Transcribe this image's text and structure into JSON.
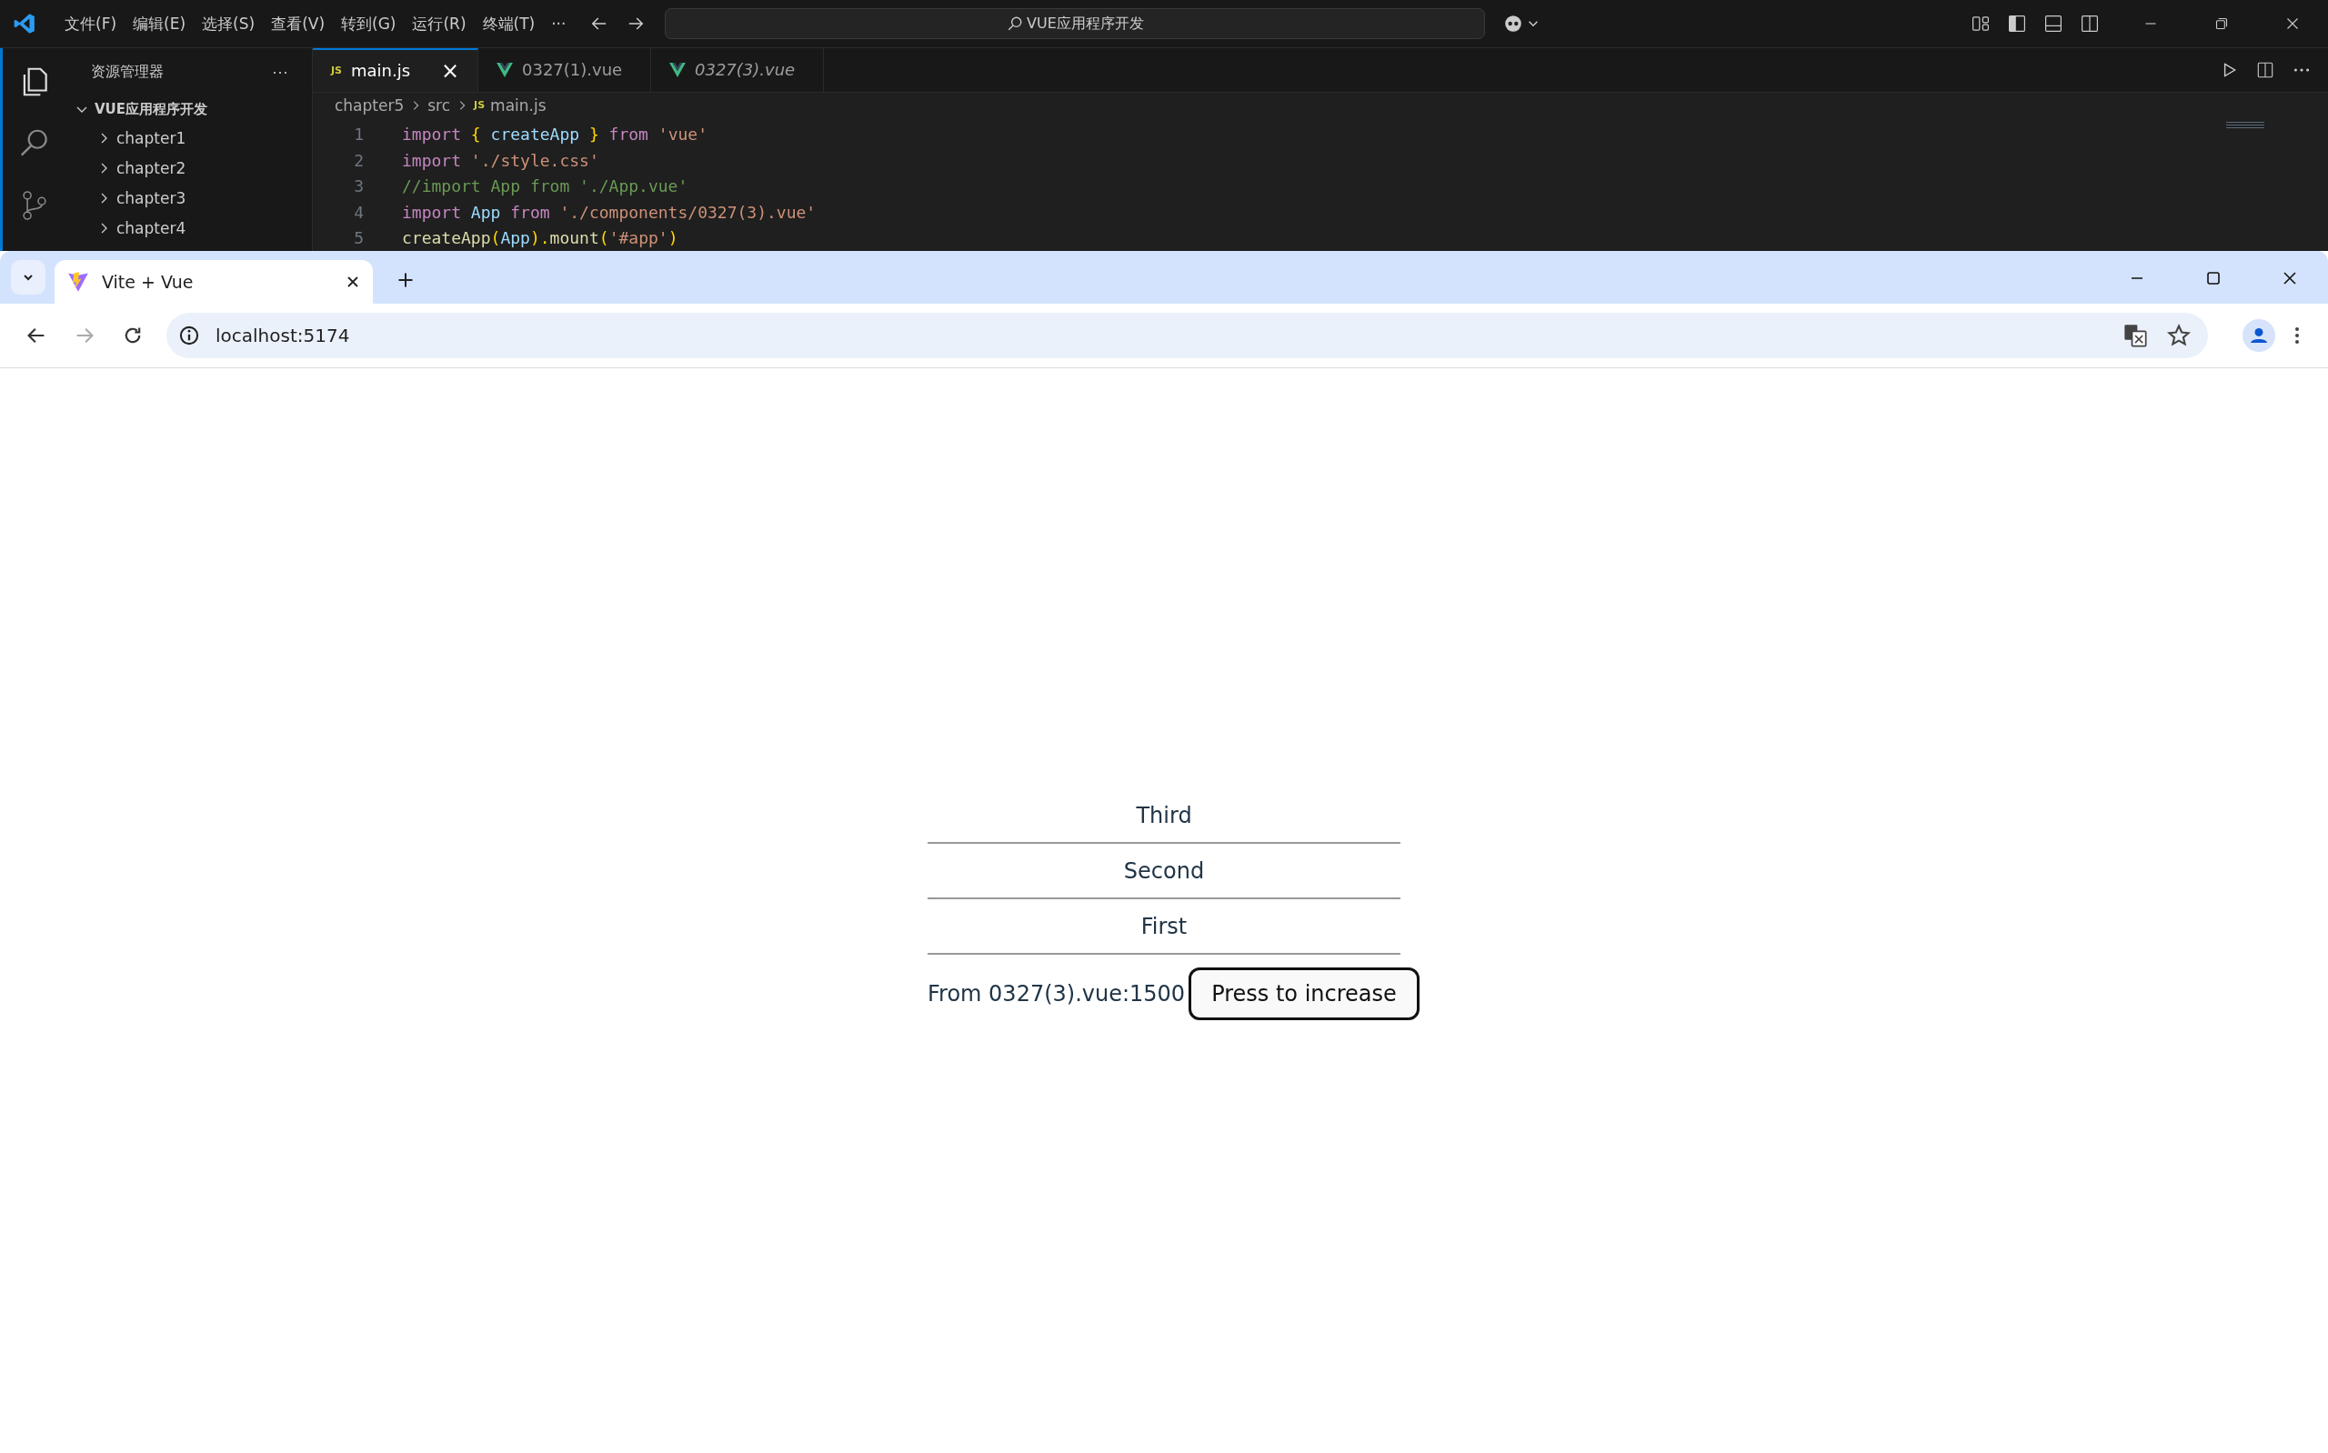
{
  "editor": {
    "menu": [
      "文件(F)",
      "编辑(E)",
      "选择(S)",
      "查看(V)",
      "转到(G)",
      "运行(R)",
      "终端(T)"
    ],
    "menu_more": "···",
    "command_center": "VUE应用程序开发",
    "explorer": {
      "title": "资源管理器",
      "more": "···",
      "root": {
        "label": "VUE应用程序开发",
        "expanded": true,
        "children": [
          {
            "label": "chapter1",
            "expanded": false
          },
          {
            "label": "chapter2",
            "expanded": false
          },
          {
            "label": "chapter3",
            "expanded": false
          },
          {
            "label": "chapter4",
            "expanded": false
          }
        ]
      }
    },
    "tabs": [
      {
        "label": "main.js",
        "kind": "js",
        "badge": "JS",
        "selected": true,
        "italic": false,
        "close": "×"
      },
      {
        "label": "0327(1).vue",
        "kind": "vue",
        "selected": false,
        "italic": false
      },
      {
        "label": "0327(3).vue",
        "kind": "vue",
        "selected": false,
        "italic": true
      }
    ],
    "breadcrumb": [
      {
        "label": "chapter5"
      },
      {
        "label": "src"
      },
      {
        "label": "main.js",
        "badge": "JS"
      }
    ],
    "code": [
      {
        "number": "1",
        "tokens": [
          {
            "text": "import",
            "kind": "keyword"
          },
          {
            "text": " { ",
            "kind": "bracket"
          },
          {
            "text": "createApp",
            "kind": "variable"
          },
          {
            "text": " } ",
            "kind": "bracket"
          },
          {
            "text": "from",
            "kind": "keyword"
          },
          {
            "text": " 'vue'",
            "kind": "string"
          }
        ]
      },
      {
        "number": "2",
        "tokens": [
          {
            "text": "import",
            "kind": "keyword"
          },
          {
            "text": " './style.css'",
            "kind": "string"
          }
        ]
      },
      {
        "number": "3",
        "tokens": [
          {
            "text": "//import App from './App.vue'",
            "kind": "comment"
          }
        ]
      },
      {
        "number": "4",
        "tokens": [
          {
            "text": "import",
            "kind": "keyword"
          },
          {
            "text": " App ",
            "kind": "variable"
          },
          {
            "text": "from",
            "kind": "keyword"
          },
          {
            "text": " './components/0327(3).vue'",
            "kind": "string"
          }
        ]
      },
      {
        "number": "5",
        "tokens": [
          {
            "text": "createApp",
            "kind": "function"
          },
          {
            "text": "(",
            "kind": "bracket"
          },
          {
            "text": "App",
            "kind": "variable"
          },
          {
            "text": ").",
            "kind": "bracket"
          },
          {
            "text": "mount",
            "kind": "function"
          },
          {
            "text": "(",
            "kind": "bracket"
          },
          {
            "text": "'#app'",
            "kind": "string"
          },
          {
            "text": ")",
            "kind": "bracket"
          }
        ]
      }
    ]
  },
  "browser": {
    "tabs": [
      {
        "title": "Vite + Vue",
        "selected": true
      }
    ],
    "url": "localhost:5174",
    "page": {
      "items": [
        "Third",
        "Second",
        "First"
      ],
      "text": "From 0327(3).vue:1500",
      "button": "Press to increase"
    }
  }
}
